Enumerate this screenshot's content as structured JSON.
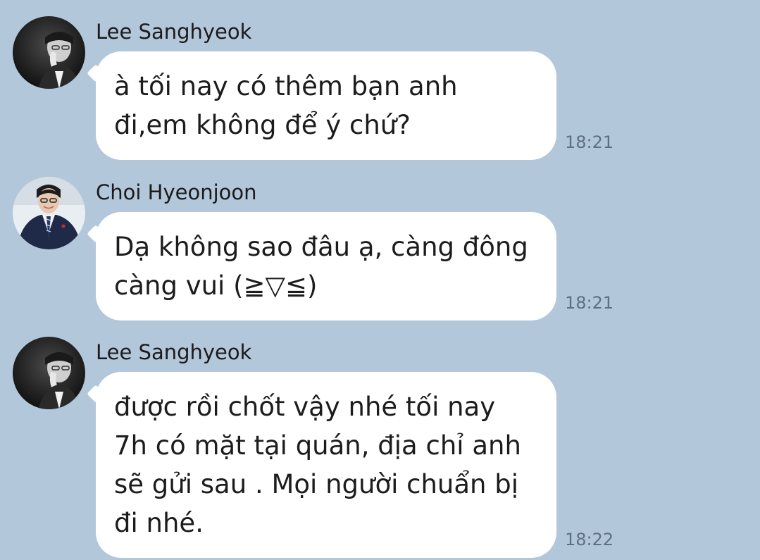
{
  "colors": {
    "background": "#b3c7db",
    "bubble": "#ffffff",
    "text": "#1c1c1c",
    "timestamp": "#5f6f80"
  },
  "messages": [
    {
      "sender": "Lee Sanghyeok",
      "avatar_icon": "avatar-lee-sanghyeok",
      "text": "à tối nay có thêm bạn anh\nđi,em không để ý chứ?",
      "time": "18:21"
    },
    {
      "sender": "Choi Hyeonjoon",
      "avatar_icon": "avatar-choi-hyeonjoon",
      "text": "Dạ không sao đâu ạ, càng đông\ncàng vui (≧▽≦)",
      "time": "18:21"
    },
    {
      "sender": "Lee Sanghyeok",
      "avatar_icon": "avatar-lee-sanghyeok",
      "text": "được rồi chốt vậy nhé tối nay\n7h có mặt tại quán, địa chỉ anh\nsẽ gửi sau . Mọi người chuẩn bị\nđi nhé.",
      "time": "18:22"
    }
  ]
}
